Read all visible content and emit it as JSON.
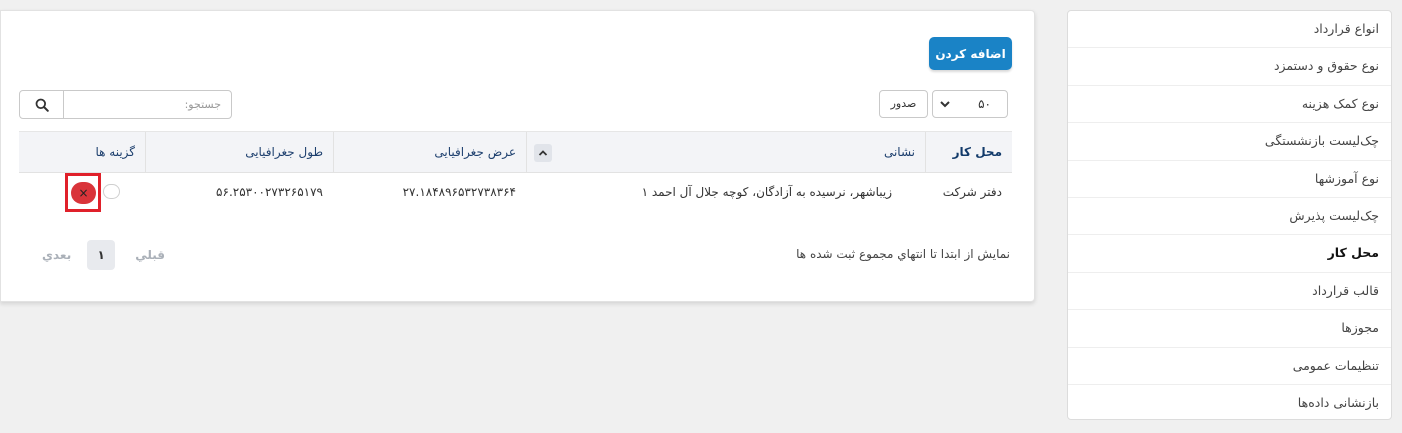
{
  "sidebar": {
    "items": [
      {
        "label": "انواع قرارداد",
        "active": false
      },
      {
        "label": "نوع حقوق و دستمزد",
        "active": false
      },
      {
        "label": "نوع کمک هزینه",
        "active": false
      },
      {
        "label": "چک‌لیست بازنشستگی",
        "active": false
      },
      {
        "label": "نوع آموزشها",
        "active": false
      },
      {
        "label": "چک‌لیست پذیرش",
        "active": false
      },
      {
        "label": "محل کار",
        "active": true
      },
      {
        "label": "قالب قرارداد",
        "active": false
      },
      {
        "label": "مجوزها",
        "active": false
      },
      {
        "label": "تنظیمات عمومی",
        "active": false
      },
      {
        "label": "بازنشانی داده‌ها",
        "active": false
      }
    ]
  },
  "toolbar": {
    "add_label": "اضافه کردن",
    "export_label": "صدور",
    "page_size": "۵۰",
    "search_placeholder": "جستجو:",
    "search_value": ""
  },
  "table": {
    "columns": [
      "محل کار",
      "نشانی",
      "عرض جغرافیایی",
      "طول جغرافیایی",
      "گزینه ها"
    ],
    "rows": [
      {
        "workplace": "دفتر شرکت",
        "address": "زیباشهر، نرسیده به آزادگان، کوچه جلال آل احمد ۱",
        "latitude": "۲۷.۱۸۴۸۹۶۵۳۲۷۳۸۳۶۴",
        "longitude": "۵۶.۲۵۳۰۰۲۷۳۲۶۵۱۷۹",
        "delete_glyph": "×"
      }
    ]
  },
  "footer": {
    "info": "نمایش از ابتدا تا انتهاي مجموع ثبت شده ها",
    "prev_label": "قبلي",
    "current_page": "۱",
    "next_label": "بعدي"
  },
  "colors": {
    "primary": "#1a83c6",
    "danger": "#d9343a",
    "highlight": "#e0202a",
    "header_bg": "#f3f4f7"
  }
}
